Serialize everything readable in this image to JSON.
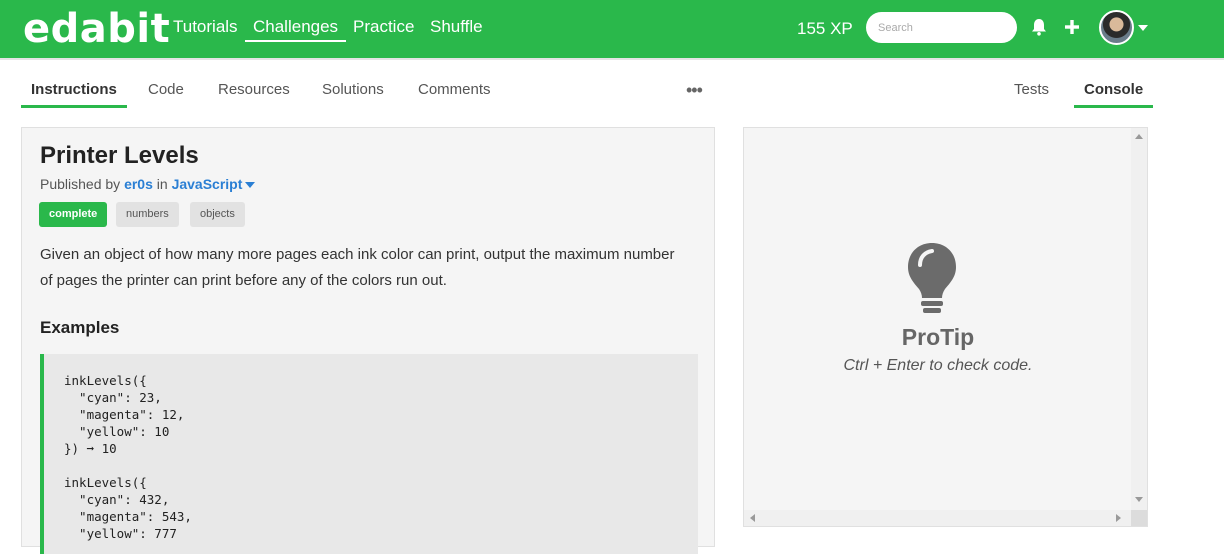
{
  "header": {
    "logo": "edabit",
    "nav": [
      "Tutorials",
      "Challenges",
      "Practice",
      "Shuffle"
    ],
    "active_nav": "Challenges",
    "xp": "155 XP",
    "search_placeholder": "Search"
  },
  "tabs": {
    "left": [
      "Instructions",
      "Code",
      "Resources",
      "Solutions",
      "Comments"
    ],
    "right": [
      "Tests",
      "Console"
    ],
    "active_left": "Instructions",
    "active_right": "Console",
    "more": "•••"
  },
  "challenge": {
    "title": "Printer Levels",
    "published_prefix": "Published by",
    "author": "er0s",
    "in_word": "in",
    "language": "JavaScript",
    "tags": [
      "complete",
      "numbers",
      "objects"
    ],
    "description": "Given an object of how many more pages each ink color can print, output the maximum number of pages the printer can print before any of the colors run out.",
    "examples_heading": "Examples",
    "code": "inkLevels({\n  \"cyan\": 23,\n  \"magenta\": 12,\n  \"yellow\": 10\n}) ➞ 10\n\ninkLevels({\n  \"cyan\": 432,\n  \"magenta\": 543,\n  \"yellow\": 777"
  },
  "console": {
    "protip_title": "ProTip",
    "protip_text": "Ctrl + Enter to check code."
  },
  "colors": {
    "brand": "#2ab84b",
    "link": "#2a7fd4"
  },
  "icons": [
    "bell-icon",
    "plus-icon",
    "avatar",
    "lightbulb-icon"
  ]
}
